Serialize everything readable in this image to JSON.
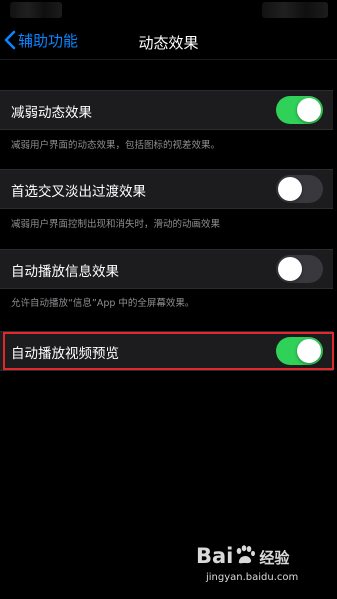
{
  "nav": {
    "back_label": "辅助功能",
    "title": "动态效果"
  },
  "settings": [
    {
      "label": "减弱动态效果",
      "description": "减弱用户界面的动态效果，包括图标的视差效果。",
      "toggle_on": true
    },
    {
      "label": "首选交叉淡出过渡效果",
      "description": "减弱用户界面控制出现和消失时，滑动的动画效果",
      "toggle_on": false
    },
    {
      "label": "自动播放信息效果",
      "description": "允许自动播放“信息”App 中的全屏幕效果。",
      "toggle_on": false
    },
    {
      "label": "自动播放视频预览",
      "description": "",
      "toggle_on": true
    }
  ],
  "colors": {
    "background": "#000000",
    "cell": "#1c1c1e",
    "accent_blue": "#0a84ff",
    "toggle_on": "#30d158",
    "toggle_off": "#39393d",
    "highlight_red": "#e0282e",
    "secondary_text": "#8e8e93"
  },
  "icons": {
    "back": "chevron-left-icon"
  },
  "watermark": {
    "logo_prefix": "Bai",
    "logo_suffix": "经验",
    "url": "jingyan.baidu.com"
  }
}
